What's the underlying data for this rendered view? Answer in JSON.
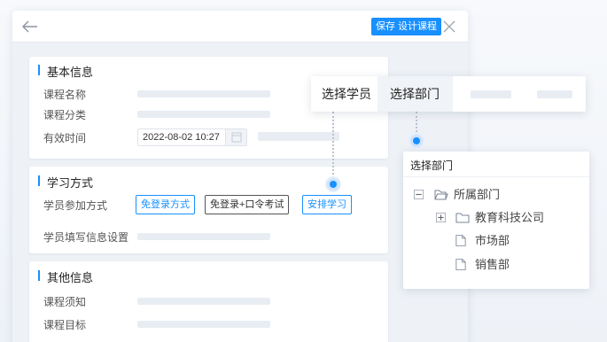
{
  "toolbar": {
    "save_label": "保存 设计课程"
  },
  "sections": {
    "basic": {
      "title": "基本信息",
      "course_name_label": "课程名称",
      "course_category_label": "课程分类",
      "valid_time_label": "有效时间",
      "valid_time_value": "2022-08-02 10:27"
    },
    "study": {
      "title": "学习方式",
      "participation_label": "学员参加方式",
      "options": [
        "免登录方式",
        "免登录+口令考试",
        "安排学习"
      ],
      "fill_info_label": "学员填写信息设置"
    },
    "other": {
      "title": "其他信息",
      "notice_label": "课程须知",
      "goal_label": "课程目标"
    }
  },
  "assign_tabs": [
    "选择学员",
    "选择部门"
  ],
  "dept_picker": {
    "title": "选择部门",
    "tree": [
      {
        "label": "所属部门",
        "expander": "minus",
        "icon": "folder-open-icon"
      },
      {
        "label": "教育科技公司",
        "expander": "plus",
        "icon": "folder-icon"
      },
      {
        "label": "市场部",
        "icon": "file-icon"
      },
      {
        "label": "销售部",
        "icon": "file-icon"
      }
    ]
  },
  "colors": {
    "accent": "#1890ff",
    "panel_bg": "#eef2f7"
  }
}
